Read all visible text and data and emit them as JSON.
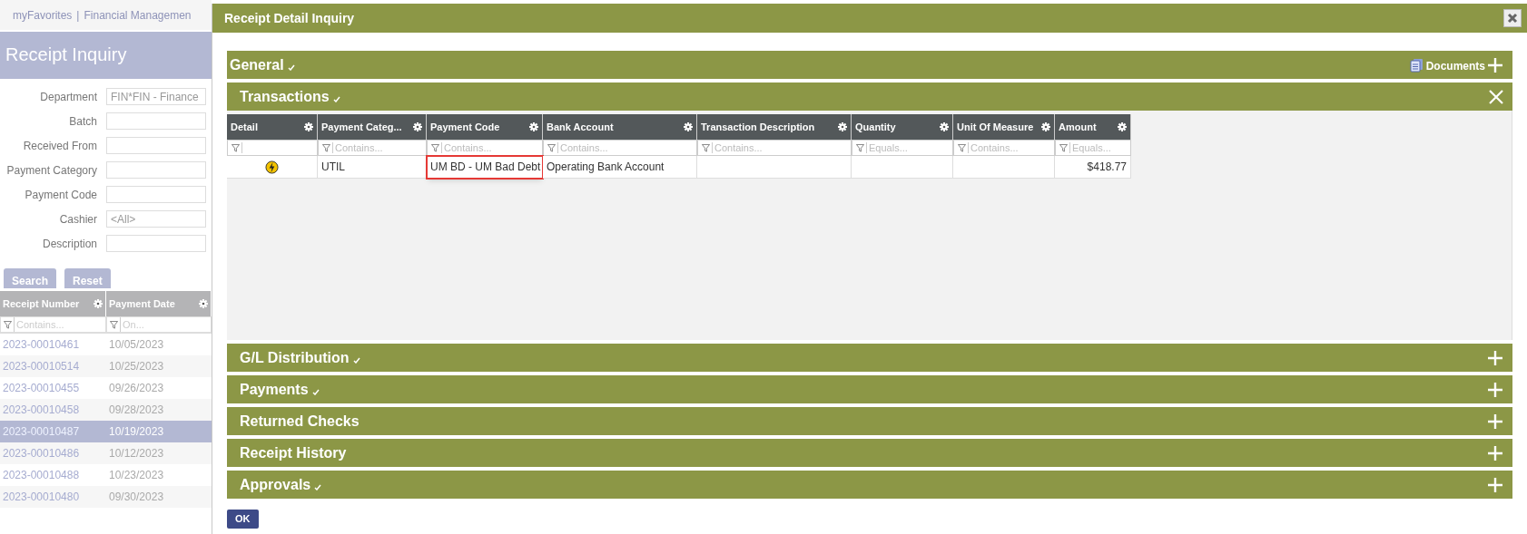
{
  "top_nav": {
    "links": [
      "myFavorites",
      "Financial Managemen"
    ],
    "separator": "|"
  },
  "inquiry": {
    "title": "Receipt Inquiry",
    "fields": [
      {
        "label": "Department",
        "value": "FIN*FIN - Finance"
      },
      {
        "label": "Batch"
      },
      {
        "label": "Received From"
      },
      {
        "label": "Payment Category"
      },
      {
        "label": "Payment Code"
      },
      {
        "label": "Cashier",
        "value": "<All>"
      },
      {
        "label": "Description"
      }
    ],
    "buttons": [
      "Search",
      "Reset"
    ],
    "grid": {
      "columns": [
        {
          "label": "Receipt Number",
          "filter": "Contains..."
        },
        {
          "label": "Payment Date",
          "filter": "On..."
        }
      ],
      "rows": [
        {
          "cells": [
            "2023-00010461",
            "10/05/2023"
          ],
          "selected": false
        },
        {
          "cells": [
            "2023-00010514",
            "10/25/2023"
          ],
          "selected": false
        },
        {
          "cells": [
            "2023-00010455",
            "09/26/2023"
          ],
          "selected": false
        },
        {
          "cells": [
            "2023-00010458",
            "09/28/2023"
          ],
          "selected": false
        },
        {
          "cells": [
            "2023-00010487",
            "10/19/2023"
          ],
          "selected": true
        },
        {
          "cells": [
            "2023-00010486",
            "10/12/2023"
          ],
          "selected": false
        },
        {
          "cells": [
            "2023-00010488",
            "10/23/2023"
          ],
          "selected": false
        },
        {
          "cells": [
            "2023-00010480",
            "09/30/2023"
          ],
          "selected": false
        }
      ]
    }
  },
  "dialog": {
    "title": "Receipt Detail Inquiry",
    "sections": [
      {
        "title": "General",
        "checked": true,
        "expanded": false,
        "documents_label": "Documents"
      },
      {
        "title": "Transactions",
        "checked": true,
        "expanded": true
      },
      {
        "title": "G/L Distribution",
        "checked": true,
        "expanded": false
      },
      {
        "title": "Payments",
        "checked": true,
        "expanded": false
      },
      {
        "title": "Returned Checks",
        "checked": false,
        "expanded": false
      },
      {
        "title": "Receipt History",
        "checked": false,
        "expanded": false
      },
      {
        "title": "Approvals",
        "checked": true,
        "expanded": false
      }
    ],
    "table": {
      "columns": [
        {
          "label": "Detail"
        },
        {
          "label": "Payment Categ...",
          "filter": "Contains..."
        },
        {
          "label": "Payment Code",
          "filter": "Contains..."
        },
        {
          "label": "Bank Account",
          "filter": "Contains..."
        },
        {
          "label": "Transaction Description",
          "filter": "Contains..."
        },
        {
          "label": "Quantity",
          "filter": "Equals..."
        },
        {
          "label": "Unit Of Measure",
          "filter": "Contains..."
        },
        {
          "label": "Amount",
          "filter": "Equals..."
        }
      ],
      "rows": [
        {
          "cells": [
            null,
            "UTIL",
            "UM BD - UM Bad Debt",
            "Operating Bank Account",
            null,
            null,
            null,
            "$418.77"
          ],
          "highlighted": [
            false,
            false,
            true,
            false,
            false,
            false,
            false,
            false
          ]
        }
      ]
    },
    "ok_button": "OK"
  }
}
